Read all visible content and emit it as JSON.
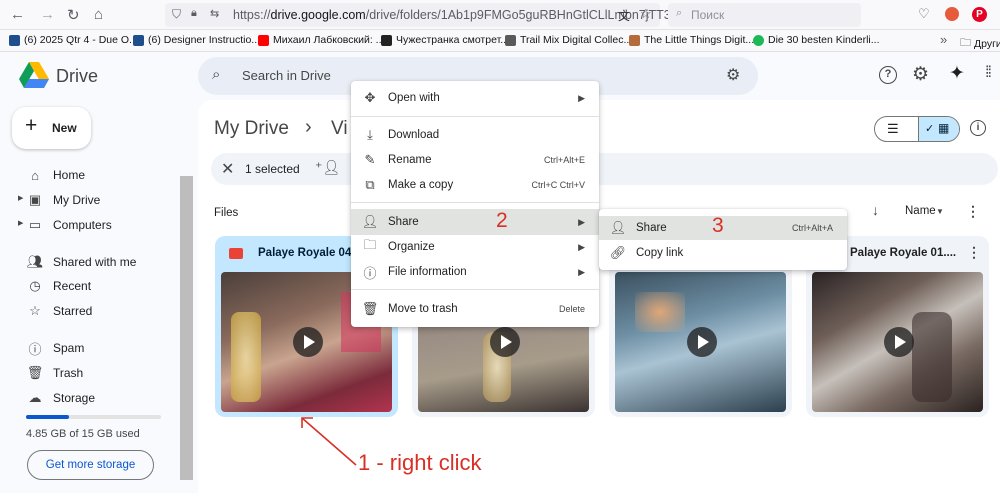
{
  "browser": {
    "url": "https://drive.google.com/drive/folders/1Ab1p9FMGo5guRBHnGtlCLlLmbn7jTT3z",
    "url_host": "drive.google.com",
    "url_prefix": "https://",
    "url_rest": "/drive/folders/1Ab1p9FMGo5guRBHnGtlCLlLmbn7jTT3z",
    "search_placeholder": "Поиск"
  },
  "bookmarks": [
    {
      "label": "(6) 2025 Qtr 4 - Due O...",
      "color": "#1f4e8c"
    },
    {
      "label": "(6) Designer Instructio...",
      "color": "#1f4e8c"
    },
    {
      "label": "Михаил Лабковский: ...",
      "color": "#ff0000"
    },
    {
      "label": "Чужестранка смотрет...",
      "color": "#222222"
    },
    {
      "label": "Trail Mix Digital Collec...",
      "color": "#5a5a5a"
    },
    {
      "label": "The Little Things Digit...",
      "color": "#b56a3a"
    },
    {
      "label": "Die 30 besten Kinderli...",
      "color": "#1db954"
    },
    {
      "label": "Други",
      "color": "#5b5b66"
    }
  ],
  "drive": {
    "logo_text": "Drive",
    "search_placeholder": "Search in Drive",
    "new_button": "New",
    "breadcrumb_root": "My Drive",
    "breadcrumb_sep": "›",
    "breadcrumb_current": "Vi",
    "selection_text": "1 selected",
    "section_label": "Files",
    "sort_label": "Name"
  },
  "sidebar": {
    "items": [
      {
        "label": "Home",
        "icon": "home-icon"
      },
      {
        "label": "My Drive",
        "icon": "my-drive-icon"
      },
      {
        "label": "Computers",
        "icon": "computers-icon"
      },
      {
        "label": "Shared with me",
        "icon": "shared-icon"
      },
      {
        "label": "Recent",
        "icon": "clock-icon"
      },
      {
        "label": "Starred",
        "icon": "star-icon"
      },
      {
        "label": "Spam",
        "icon": "spam-icon"
      },
      {
        "label": "Trash",
        "icon": "trash-icon"
      },
      {
        "label": "Storage",
        "icon": "cloud-icon"
      }
    ],
    "storage_text": "4.85 GB of 15 GB used",
    "storage_fraction": 0.32,
    "get_storage_button": "Get more storage"
  },
  "files": [
    {
      "name": "Palaye Royale 04...",
      "selected": true
    },
    {
      "name": "",
      "selected": false
    },
    {
      "name": "",
      "selected": false
    },
    {
      "name": "Palaye Royale 01....",
      "selected": false
    }
  ],
  "context_menu": {
    "items": [
      {
        "label": "Open with",
        "shortcut": "",
        "submenu": true
      },
      {
        "label": "Download",
        "shortcut": "",
        "submenu": false
      },
      {
        "label": "Rename",
        "shortcut": "Ctrl+Alt+E",
        "submenu": false
      },
      {
        "label": "Make a copy",
        "shortcut": "Ctrl+C Ctrl+V",
        "submenu": false
      },
      {
        "label": "Share",
        "shortcut": "",
        "submenu": true
      },
      {
        "label": "Organize",
        "shortcut": "",
        "submenu": true
      },
      {
        "label": "File information",
        "shortcut": "",
        "submenu": true
      },
      {
        "label": "Move to trash",
        "shortcut": "Delete",
        "submenu": false
      }
    ]
  },
  "share_submenu": {
    "items": [
      {
        "label": "Share",
        "shortcut": "Ctrl+Alt+A"
      },
      {
        "label": "Copy link",
        "shortcut": ""
      }
    ]
  },
  "annotations": {
    "step1": "1 - right click",
    "step2": "2",
    "step3": "3",
    "color": "#d93025"
  }
}
